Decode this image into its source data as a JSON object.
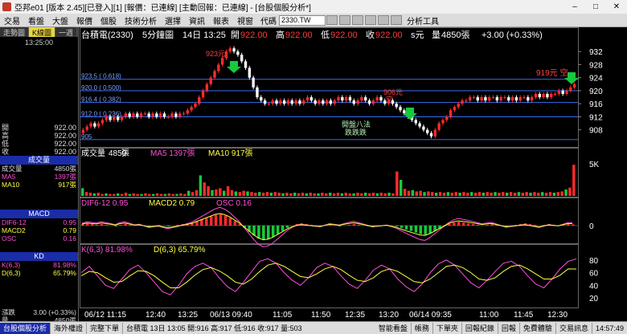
{
  "window": {
    "title": "亞邦e01 [版本 2.45][已登入][1] [報價：已連線] [主動回報：已連線] - [台股個股分析*]",
    "minimize": "–",
    "maximize": "□",
    "close": "✕"
  },
  "menu": {
    "items": [
      "交易",
      "看盤",
      "大盤",
      "報價",
      "個股",
      "技術分析",
      "選擇",
      "資訊",
      "報表",
      "視窗"
    ],
    "code_label": "代碼",
    "code_value": "2330.TW",
    "tools_label": "分析工具"
  },
  "left": {
    "tabs": [
      "走勢圖",
      "K線圖",
      "一週"
    ],
    "time": "13:25:00",
    "quotes": [
      {
        "label": "開",
        "value": "922.00"
      },
      {
        "label": "高",
        "value": "922.00"
      },
      {
        "label": "低",
        "value": "922.00"
      },
      {
        "label": "收",
        "value": "922.00"
      }
    ],
    "vol_header": "成交量",
    "vol_rows": [
      {
        "label": "成交量",
        "value": "4850張"
      },
      {
        "label": "MA5",
        "value": "1397張"
      },
      {
        "label": "MA10",
        "value": "917張"
      }
    ],
    "macd_header": "MACD",
    "macd_rows": [
      {
        "label": "DIF6-12",
        "value": "0.95"
      },
      {
        "label": "MACD2",
        "value": "0.79"
      },
      {
        "label": "OSC",
        "value": "0.16"
      }
    ],
    "kd_header": "KD",
    "kd_rows": [
      {
        "label": "K(6,3)",
        "value": "81.98%"
      },
      {
        "label": "D(6,3)",
        "value": "65.79%"
      }
    ],
    "change_label": "漲跌",
    "change_value": "3.00 (+0.33%)",
    "qty_label": "量",
    "qty_value": "4850張"
  },
  "chart_header": {
    "name": "台積電(2330)",
    "period": "5分鐘圖",
    "date_time": "14日 13:25",
    "open_label": "開",
    "open": "922.00",
    "high_label": "高",
    "high": "922.00",
    "low_label": "低",
    "low": "922.00",
    "close_label": "收",
    "close": "922.00",
    "unit": "s元",
    "vol_label": "量",
    "vol": "4850張",
    "change": "+3.00 (+0.33%)"
  },
  "annotations": {
    "peak": "923元",
    "mid": "906元",
    "mid2": "空",
    "right": "919元 空",
    "comment1": "開盤八法",
    "comment2": "跌跌跌"
  },
  "chart_data": [
    {
      "type": "candlestick",
      "title": "",
      "y_ticks": [
        932,
        928,
        924,
        920,
        916,
        912,
        908
      ],
      "ylim": [
        903,
        935
      ],
      "fib_levels": [
        {
          "label": "923.5 ( 0.618)",
          "value": 923.5
        },
        {
          "label": "920.0 ( 0.500)",
          "value": 920.0
        },
        {
          "label": "916.4 ( 0.382)",
          "value": 916.4
        },
        {
          "label": "912.0 ( 0.236)",
          "value": 912.0
        },
        {
          "label": "905",
          "value": 905.0
        }
      ],
      "x_labels": [
        "06/12 11:15",
        "12:40",
        "13:25",
        "06/13 09:40",
        "11:05",
        "11:50",
        "12:35",
        "13:20",
        "06/14 09:35",
        "11:00",
        "11:45",
        "12:30"
      ],
      "close": [
        908,
        909,
        910,
        909,
        910,
        911,
        912,
        911,
        912,
        911,
        912,
        913,
        912,
        913,
        912,
        913,
        913,
        912,
        913,
        912,
        913,
        912,
        912,
        913,
        912,
        913,
        913,
        914,
        915,
        916,
        918,
        920,
        922,
        924,
        926,
        928,
        930,
        932,
        933,
        932,
        931,
        929,
        927,
        924,
        921,
        918,
        917,
        916,
        916,
        917,
        916,
        917,
        916,
        917,
        916,
        917,
        916,
        917,
        918,
        917,
        916,
        917,
        916,
        917,
        916,
        917,
        918,
        917,
        918,
        917,
        916,
        917,
        918,
        917,
        916,
        917,
        918,
        917,
        916,
        917,
        916,
        915,
        914,
        913,
        912,
        911,
        910,
        909,
        908,
        907,
        906,
        908,
        910,
        911,
        912,
        914,
        915,
        916,
        917,
        917,
        918,
        918,
        917,
        918,
        917,
        918,
        918,
        917,
        918,
        918,
        917,
        918,
        917,
        918,
        918,
        917,
        918,
        919,
        918,
        919,
        918,
        919,
        919,
        920,
        919,
        920,
        921,
        922
      ]
    },
    {
      "type": "bar",
      "title": "成交量",
      "ylabel": "張",
      "y_ticks": [
        "5K"
      ],
      "values": [
        1.2,
        0.6,
        0.5,
        0.4,
        0.5,
        0.3,
        0.4,
        0.3,
        0.3,
        0.4,
        0.3,
        0.5,
        0.3,
        0.4,
        0.3,
        0.3,
        0.4,
        0.3,
        0.3,
        0.4,
        0.3,
        0.3,
        0.4,
        0.3,
        0.3,
        0.4,
        0.3,
        0.8,
        0.6,
        0.9,
        3.2,
        2.1,
        1.5,
        0.9,
        1.0,
        1.2,
        0.8,
        1.5,
        0.9,
        0.7,
        0.6,
        0.8,
        0.7,
        0.6,
        0.5,
        0.6,
        0.5,
        0.6,
        0.5,
        0.6,
        0.5,
        0.4,
        0.5,
        0.4,
        0.5,
        0.4,
        0.5,
        0.4,
        0.5,
        0.4,
        0.4,
        0.5,
        0.4,
        0.5,
        0.4,
        0.5,
        0.4,
        0.5,
        0.4,
        0.4,
        0.5,
        0.4,
        0.5,
        0.4,
        0.5,
        0.4,
        0.5,
        0.4,
        0.5,
        0.4,
        3.8,
        2.5,
        1.1,
        0.8,
        0.9,
        0.7,
        0.8,
        0.6,
        0.7,
        0.6,
        0.5,
        0.6,
        0.5,
        0.6,
        0.5,
        0.6,
        0.5,
        0.6,
        0.5,
        0.6,
        0.5,
        0.6,
        0.5,
        0.6,
        0.5,
        0.6,
        0.5,
        0.6,
        0.5,
        0.6,
        0.5,
        0.6,
        0.5,
        0.6,
        0.5,
        0.6,
        0.5,
        0.6,
        0.5,
        0.6,
        0.5,
        0.6,
        0.7,
        1.0,
        1.3,
        4.85
      ],
      "ylim": [
        0,
        6
      ]
    },
    {
      "type": "bar",
      "title": "MACD",
      "y_ticks": [
        0
      ],
      "values": [
        0.2,
        0.3,
        0.2,
        0.1,
        0.2,
        0.1,
        0.0,
        -0.1,
        0.1,
        0.2,
        0.1,
        0.0,
        0.1,
        0.0,
        -0.1,
        0.0,
        0.1,
        0.0,
        -0.1,
        0.0,
        0.1,
        0.2,
        0.3,
        0.4,
        0.6,
        0.8,
        1.0,
        1.2,
        1.4,
        1.5,
        1.3,
        1.0,
        0.6,
        0.2,
        -0.3,
        -0.8,
        -1.3,
        -1.7,
        -1.9,
        -1.8,
        -1.5,
        -1.1,
        -0.7,
        -0.3,
        0.0,
        0.2,
        0.3,
        0.2,
        0.1,
        0.0,
        -0.1,
        0.0,
        0.1,
        0.0,
        -0.1,
        0.0,
        0.1,
        0.2,
        0.1,
        0.0,
        -0.1,
        -0.2,
        -0.1,
        0.0,
        0.1,
        0.0,
        -0.1,
        -0.3,
        -0.5,
        -0.7,
        -0.9,
        -1.1,
        -1.2,
        -1.0,
        -0.7,
        -0.4,
        -0.1,
        0.2,
        0.4,
        0.5,
        0.4,
        0.3,
        0.2,
        0.1,
        0.0,
        0.1,
        0.2,
        0.1,
        0.0,
        -0.1,
        0.0,
        0.1,
        0.2,
        0.3,
        0.2,
        0.1,
        0.0,
        0.1,
        0.2,
        0.1,
        0.0,
        0.1,
        0.2,
        0.16
      ],
      "ylim": [
        -2.2,
        2.2
      ]
    },
    {
      "type": "line",
      "title": "KD",
      "y_ticks": [
        80,
        60,
        40,
        20
      ],
      "ylim": [
        10,
        90
      ],
      "series": [
        {
          "name": "K(6,3)",
          "values": [
            60,
            70,
            55,
            40,
            35,
            50,
            65,
            72,
            60,
            45,
            30,
            25,
            40,
            58,
            70,
            75,
            68,
            52,
            38,
            30,
            45,
            62,
            78,
            82,
            75,
            60,
            48,
            40,
            52,
            68,
            75,
            70,
            55,
            42,
            35,
            48,
            64,
            72,
            66,
            50,
            38,
            30,
            42,
            60,
            74,
            80,
            72,
            58,
            44,
            36,
            48,
            62,
            75,
            78,
            70,
            55,
            42,
            36,
            50,
            66,
            78,
            82
          ]
        },
        {
          "name": "D(6,3)",
          "values": [
            55,
            62,
            60,
            52,
            45,
            46,
            55,
            63,
            62,
            55,
            45,
            36,
            36,
            45,
            56,
            65,
            68,
            63,
            55,
            45,
            42,
            50,
            62,
            72,
            75,
            70,
            62,
            54,
            52,
            58,
            66,
            70,
            65,
            56,
            48,
            46,
            52,
            62,
            66,
            62,
            54,
            46,
            44,
            50,
            60,
            70,
            72,
            68,
            60,
            50,
            48,
            52,
            62,
            70,
            72,
            66,
            58,
            50,
            50,
            56,
            66,
            65.79
          ]
        }
      ]
    }
  ],
  "left_status": {
    "buttons": [
      "台股個股分析",
      "海外權證",
      "完整下單"
    ],
    "ticker": "台積電 13日 13:05 開:916 高:917 低:916 收:917 量:503",
    "right_buttons": [
      "智能看盤",
      "帳務",
      "下單夾",
      "回報紀錄",
      "回報",
      "免費體驗",
      "交易訊息"
    ],
    "clock": "14:57:49"
  },
  "colors": {
    "up": "#ff2b2b",
    "down": "#ffffff",
    "accent": "#ffff00",
    "arrow": "#17c93c",
    "fib": "#3a6cf0"
  }
}
